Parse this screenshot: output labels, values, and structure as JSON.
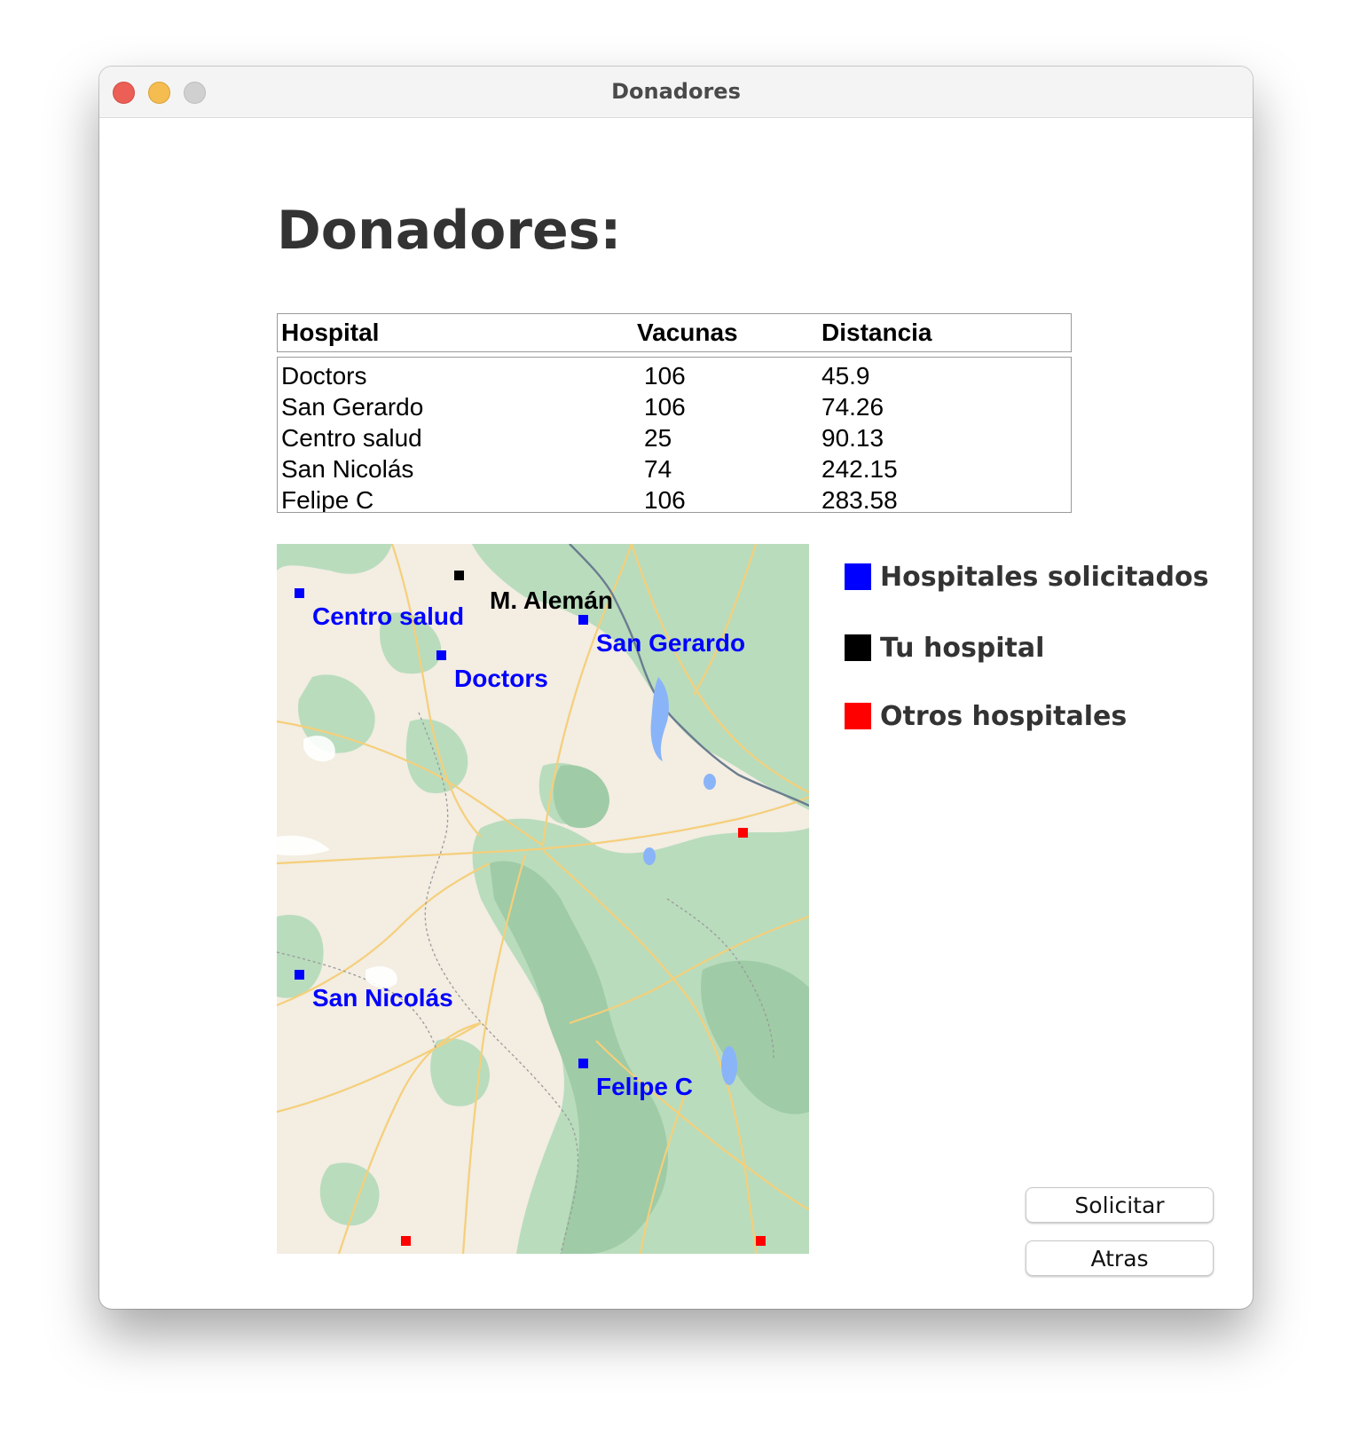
{
  "window": {
    "title": "Donadores"
  },
  "page": {
    "heading": "Donadores:"
  },
  "table": {
    "columns": [
      "Hospital",
      "Vacunas",
      "Distancia"
    ],
    "rows": [
      {
        "hospital": "Doctors",
        "vacunas": "106",
        "distancia": "45.9"
      },
      {
        "hospital": "San Gerardo",
        "vacunas": "106",
        "distancia": "74.26"
      },
      {
        "hospital": "Centro salud",
        "vacunas": "25",
        "distancia": "90.13"
      },
      {
        "hospital": "San Nicolás",
        "vacunas": "74",
        "distancia": "242.15"
      },
      {
        "hospital": "Felipe C",
        "vacunas": "106",
        "distancia": "283.58"
      }
    ]
  },
  "map": {
    "labels": {
      "centro_salud": "Centro salud",
      "m_aleman": "M. Alemán",
      "san_gerardo": "San Gerardo",
      "doctors": "Doctors",
      "san_nicolas": "San Nicolás",
      "felipe_c": "Felipe C"
    },
    "colors": {
      "requested": "#0000ff",
      "own": "#000000",
      "other": "#ff0000",
      "land": "#f3ede2",
      "forest": "#a8d5b0",
      "road": "#f5c96a",
      "water": "#8ab4f8"
    }
  },
  "legend": {
    "requested": "Hospitales solicitados",
    "own": "Tu hospital",
    "other": "Otros hospitales"
  },
  "buttons": {
    "solicitar": "Solicitar",
    "atras": "Atras"
  }
}
